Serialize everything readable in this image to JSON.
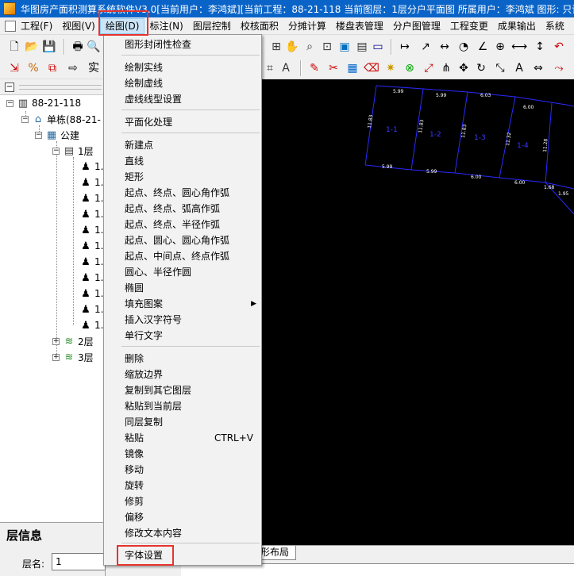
{
  "window": {
    "title": "华图房产面积测算系统软件V3.0[当前用户：李鸿斌][当前工程：88-21-118 当前图层：1层分户平面图 所属用户：李鸿斌 图形: 只读"
  },
  "menubar": {
    "items": [
      "工程(F)",
      "视图(V)",
      "绘图(D)",
      "标注(N)",
      "图层控制",
      "校核面积",
      "分摊计算",
      "楼盘表管理",
      "分户图管理",
      "工程变更",
      "成果输出",
      "系统"
    ]
  },
  "toolbar": {
    "row2_label": "实"
  },
  "tree": {
    "root": "88-21-118",
    "building": "单栋(88-21-",
    "public": "公建",
    "floor1": "1层",
    "unit_prefix": "1.",
    "floor2": "2层",
    "floor3": "3层"
  },
  "draw_menu": {
    "group1": [
      "图形封闭性检查"
    ],
    "group2": [
      "绘制实线",
      "绘制虚线",
      "虚线线型设置"
    ],
    "group3": [
      "平面化处理"
    ],
    "group4": [
      "新建点",
      "直线",
      "矩形",
      "起点、终点、圆心角作弧",
      "起点、终点、弧高作弧",
      "起点、终点、半径作弧",
      "起点、圆心、圆心角作弧",
      "起点、中间点、终点作弧",
      "圆心、半径作圆",
      "椭圆",
      "填充图案",
      "插入汉字符号",
      "单行文字"
    ],
    "group5": [
      "删除",
      "缩放边界",
      "复制到其它图层",
      "粘贴到当前层",
      "同层复制",
      "粘贴",
      "镜像",
      "移动",
      "旋转",
      "修剪",
      "偏移",
      "修改文本内容"
    ],
    "group6": [
      "字体设置"
    ],
    "paste_shortcut": "CTRL+V"
  },
  "layer_info": {
    "title": "层信息",
    "name_label": "层名:",
    "name_value": "1"
  },
  "bottom_tabs": {
    "layout_tab": "形布局"
  },
  "canvas": {
    "rooms": [
      "1-1",
      "1-2",
      "1-3",
      "1-4"
    ],
    "top_dims": [
      "5.99",
      "5.99",
      "6.03",
      "6.00"
    ],
    "bottom_dims": [
      "5.99",
      "5.99",
      "6.00",
      "6.00"
    ],
    "side_dims": [
      "11.83",
      "11.83",
      "11.83",
      "11.32",
      "11.28"
    ],
    "extra_dims": [
      "1.68",
      "1.95"
    ]
  }
}
